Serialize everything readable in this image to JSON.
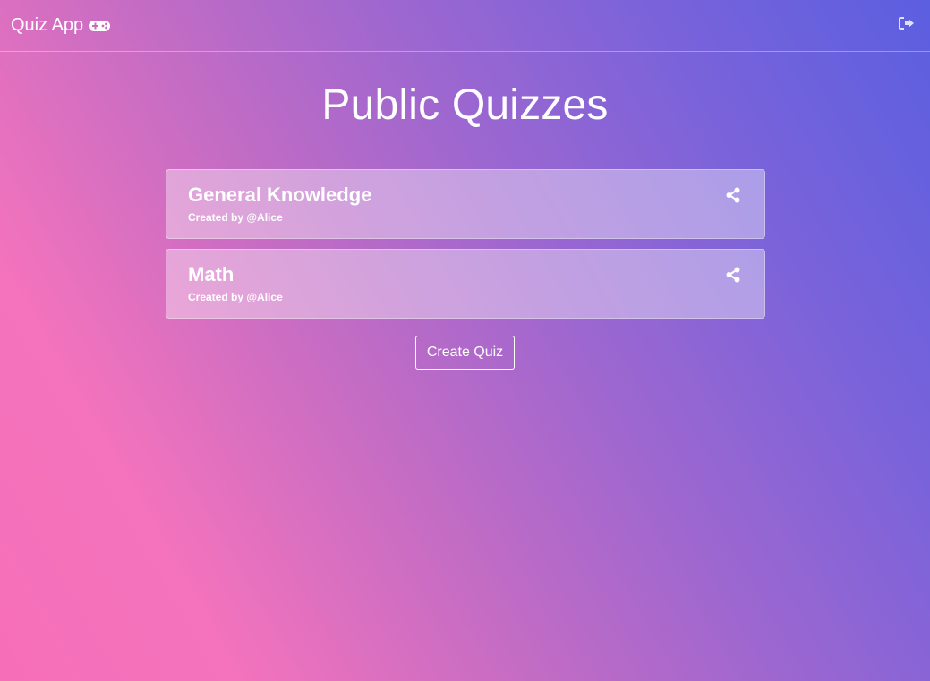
{
  "navbar": {
    "brand": "Quiz App",
    "brand_icon": "gamepad-icon",
    "logout_icon": "sign-out-icon"
  },
  "main": {
    "title": "Public Quizzes",
    "quizzes": [
      {
        "title": "General Knowledge",
        "meta": "Created by @Alice",
        "share_icon": "share-icon"
      },
      {
        "title": "Math",
        "meta": "Created by @Alice",
        "share_icon": "share-icon"
      }
    ],
    "create_label": "Create Quiz"
  },
  "colors": {
    "gradient_start": "#f66eb8",
    "gradient_end": "#5b5fe0",
    "text": "#ffffff"
  }
}
